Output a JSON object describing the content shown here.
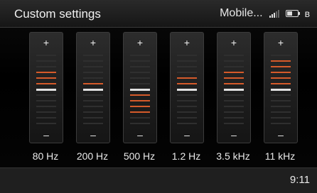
{
  "header": {
    "title": "Custom settings",
    "source": "Mobile...",
    "icons": [
      "signal-icon",
      "battery-icon",
      "bluetooth-icon"
    ]
  },
  "equalizer": {
    "plus_symbol": "+",
    "minus_symbol": "–",
    "steps_per_side": 6,
    "bands": [
      {
        "label": "80 Hz",
        "level": 3
      },
      {
        "label": "200 Hz",
        "level": 1
      },
      {
        "label": "500 Hz",
        "level": -4
      },
      {
        "label": "1.2 Hz",
        "level": 2
      },
      {
        "label": "3.5 kHz",
        "level": 3
      },
      {
        "label": "11 kHz",
        "level": 5
      }
    ]
  },
  "footer": {
    "time": "9:11"
  },
  "colors": {
    "active": "#d55a2a",
    "zero": "#e0e0e0",
    "inactive": "#2f2f2f"
  }
}
